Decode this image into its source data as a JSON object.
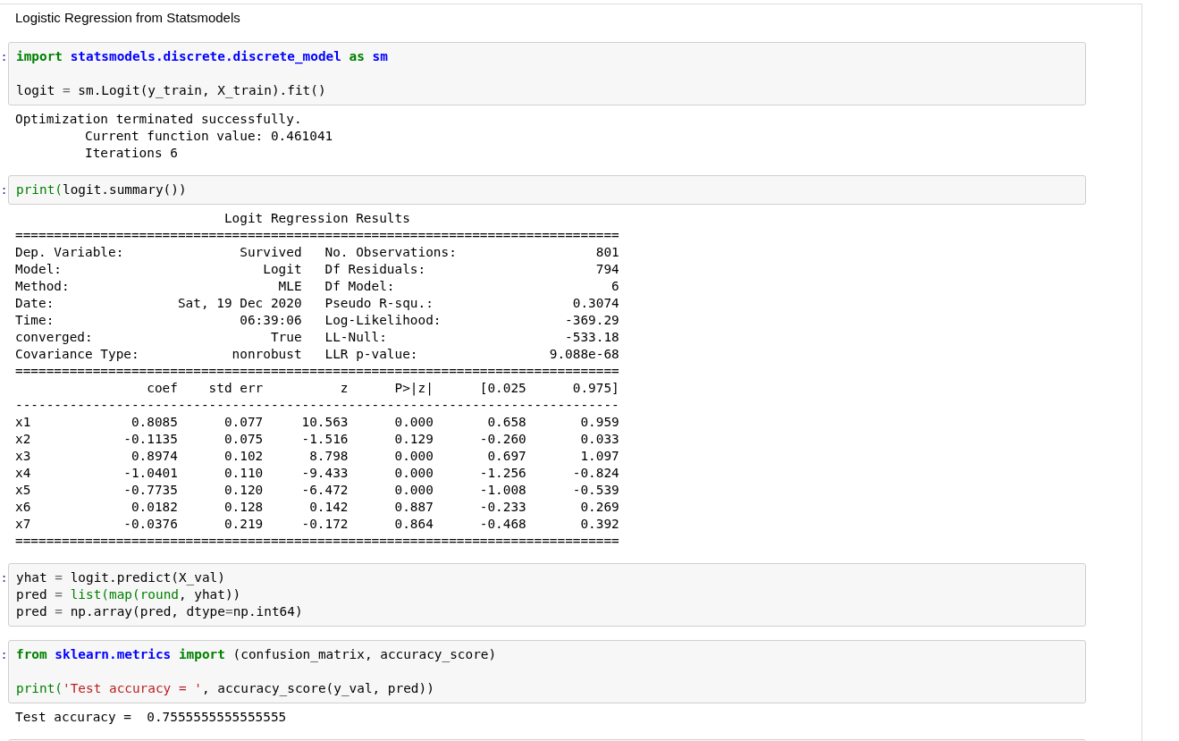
{
  "notebook": {
    "cells": [
      {
        "kind": "markdown",
        "text": "Logistic Regression from Statsmodels"
      },
      {
        "kind": "code",
        "prompt": ":",
        "lines": [
          {
            "tokens": [
              {
                "t": "import ",
                "color": "#008000",
                "bold": true
              },
              {
                "t": "statsmodels.discrete.discrete_model ",
                "color": "#0000ff",
                "bold": true
              },
              {
                "t": "as ",
                "color": "#008000",
                "bold": true
              },
              {
                "t": "sm",
                "color": "#0000ff",
                "bold": true
              }
            ]
          },
          {
            "blank_before": true,
            "tokens": [
              {
                "t": "logit ",
                "color": "#000000"
              },
              {
                "t": "=",
                "color": "#666666"
              },
              {
                "t": " sm.Logit(y_train, X_train).fit()",
                "color": "#000000"
              }
            ]
          }
        ],
        "output": {
          "kind": "stream",
          "lines": [
            "Optimization terminated successfully.",
            "         Current function value: 0.461041",
            "         Iterations 6"
          ]
        }
      },
      {
        "kind": "code",
        "prompt": ":",
        "lines": [
          {
            "tokens": [
              {
                "t": "print(",
                "color": "#008000"
              },
              {
                "t": "logit.summary())",
                "color": "#000000"
              }
            ]
          }
        ],
        "output": {
          "kind": "summary",
          "parts": [
            {
              "kind": "title",
              "text": "Logit Regression Results"
            },
            {
              "kind": "rule",
              "text": "=============================================================================="
            },
            {
              "kind": "info",
              "rows": [
                {
                  "label": "Dep. Variable:",
                  "value": "Survived",
                  "label2": "No. Observations:",
                  "value2": "801"
                },
                {
                  "label": "Model:",
                  "value": "Logit",
                  "label2": "Df Residuals:",
                  "value2": "794"
                },
                {
                  "label": "Method:",
                  "value": "MLE",
                  "label2": "Df Model:",
                  "value2": "6"
                },
                {
                  "label": "Date:",
                  "value": "Sat, 19 Dec 2020",
                  "label2": "Pseudo R-squ.:",
                  "value2": "0.3074"
                },
                {
                  "label": "Time:",
                  "value": "06:39:06",
                  "label2": "Log-Likelihood:",
                  "value2": "-369.29"
                },
                {
                  "label": "converged:",
                  "value": "True",
                  "label2": "LL-Null:",
                  "value2": "-533.18"
                },
                {
                  "label": "Covariance Type:",
                  "value": "nonrobust",
                  "label2": "LLR p-value:",
                  "value2": "9.088e-68"
                }
              ]
            },
            {
              "kind": "rule",
              "text": "=============================================================================="
            },
            {
              "kind": "header",
              "cells": [
                "coef",
                "std err",
                "z",
                "P>|z|",
                "[0.025",
                "0.975]"
              ]
            },
            {
              "kind": "rule",
              "text": "------------------------------------------------------------------------------"
            },
            {
              "kind": "coef",
              "rows": [
                {
                  "name": "x1",
                  "values": [
                    "0.8085",
                    "0.077",
                    "10.563",
                    "0.000",
                    "0.658",
                    "0.959"
                  ]
                },
                {
                  "name": "x2",
                  "values": [
                    "-0.1135",
                    "0.075",
                    "-1.516",
                    "0.129",
                    "-0.260",
                    "0.033"
                  ]
                },
                {
                  "name": "x3",
                  "values": [
                    "0.8974",
                    "0.102",
                    "8.798",
                    "0.000",
                    "0.697",
                    "1.097"
                  ]
                },
                {
                  "name": "x4",
                  "values": [
                    "-1.0401",
                    "0.110",
                    "-9.433",
                    "0.000",
                    "-1.256",
                    "-0.824"
                  ]
                },
                {
                  "name": "x5",
                  "values": [
                    "-0.7735",
                    "0.120",
                    "-6.472",
                    "0.000",
                    "-1.008",
                    "-0.539"
                  ]
                },
                {
                  "name": "x6",
                  "values": [
                    "0.0182",
                    "0.128",
                    "0.142",
                    "0.887",
                    "-0.233",
                    "0.269"
                  ]
                },
                {
                  "name": "x7",
                  "values": [
                    "-0.0376",
                    "0.219",
                    "-0.172",
                    "0.864",
                    "-0.468",
                    "0.392"
                  ]
                }
              ]
            },
            {
              "kind": "rule",
              "text": "=============================================================================="
            }
          ]
        }
      },
      {
        "kind": "code",
        "prompt": ":",
        "lines": [
          {
            "tokens": [
              {
                "t": "yhat ",
                "color": "#000000"
              },
              {
                "t": "=",
                "color": "#666666"
              },
              {
                "t": " logit.predict(X_val)",
                "color": "#000000"
              }
            ]
          },
          {
            "tokens": [
              {
                "t": "pred ",
                "color": "#000000"
              },
              {
                "t": "= ",
                "color": "#666666"
              },
              {
                "t": "list(",
                "color": "#008000"
              },
              {
                "t": "map(",
                "color": "#008000"
              },
              {
                "t": "round",
                "color": "#008000"
              },
              {
                "t": ", yhat))",
                "color": "#000000"
              }
            ]
          },
          {
            "tokens": [
              {
                "t": "pred ",
                "color": "#000000"
              },
              {
                "t": "=",
                "color": "#666666"
              },
              {
                "t": " np.array(pred, dtype",
                "color": "#000000"
              },
              {
                "t": "=",
                "color": "#666666"
              },
              {
                "t": "np.int64)",
                "color": "#000000"
              }
            ]
          }
        ]
      },
      {
        "kind": "code",
        "prompt": ":",
        "lines": [
          {
            "tokens": [
              {
                "t": "from ",
                "color": "#008000",
                "bold": true
              },
              {
                "t": "sklearn.metrics ",
                "color": "#0000ff",
                "bold": true
              },
              {
                "t": "import",
                "color": "#008000",
                "bold": true
              },
              {
                "t": " (confusion_matrix, accuracy_score)",
                "color": "#000000"
              }
            ]
          },
          {
            "blank_before": true,
            "tokens": [
              {
                "t": "print(",
                "color": "#008000"
              },
              {
                "t": "'Test accuracy = '",
                "color": "#ba2121"
              },
              {
                "t": ", accuracy_score(y_val, pred))",
                "color": "#000000"
              }
            ]
          }
        ],
        "output": {
          "kind": "stream",
          "lines": [
            "Test accuracy =  0.7555555555555555"
          ]
        }
      },
      {
        "kind": "code"
      }
    ]
  }
}
